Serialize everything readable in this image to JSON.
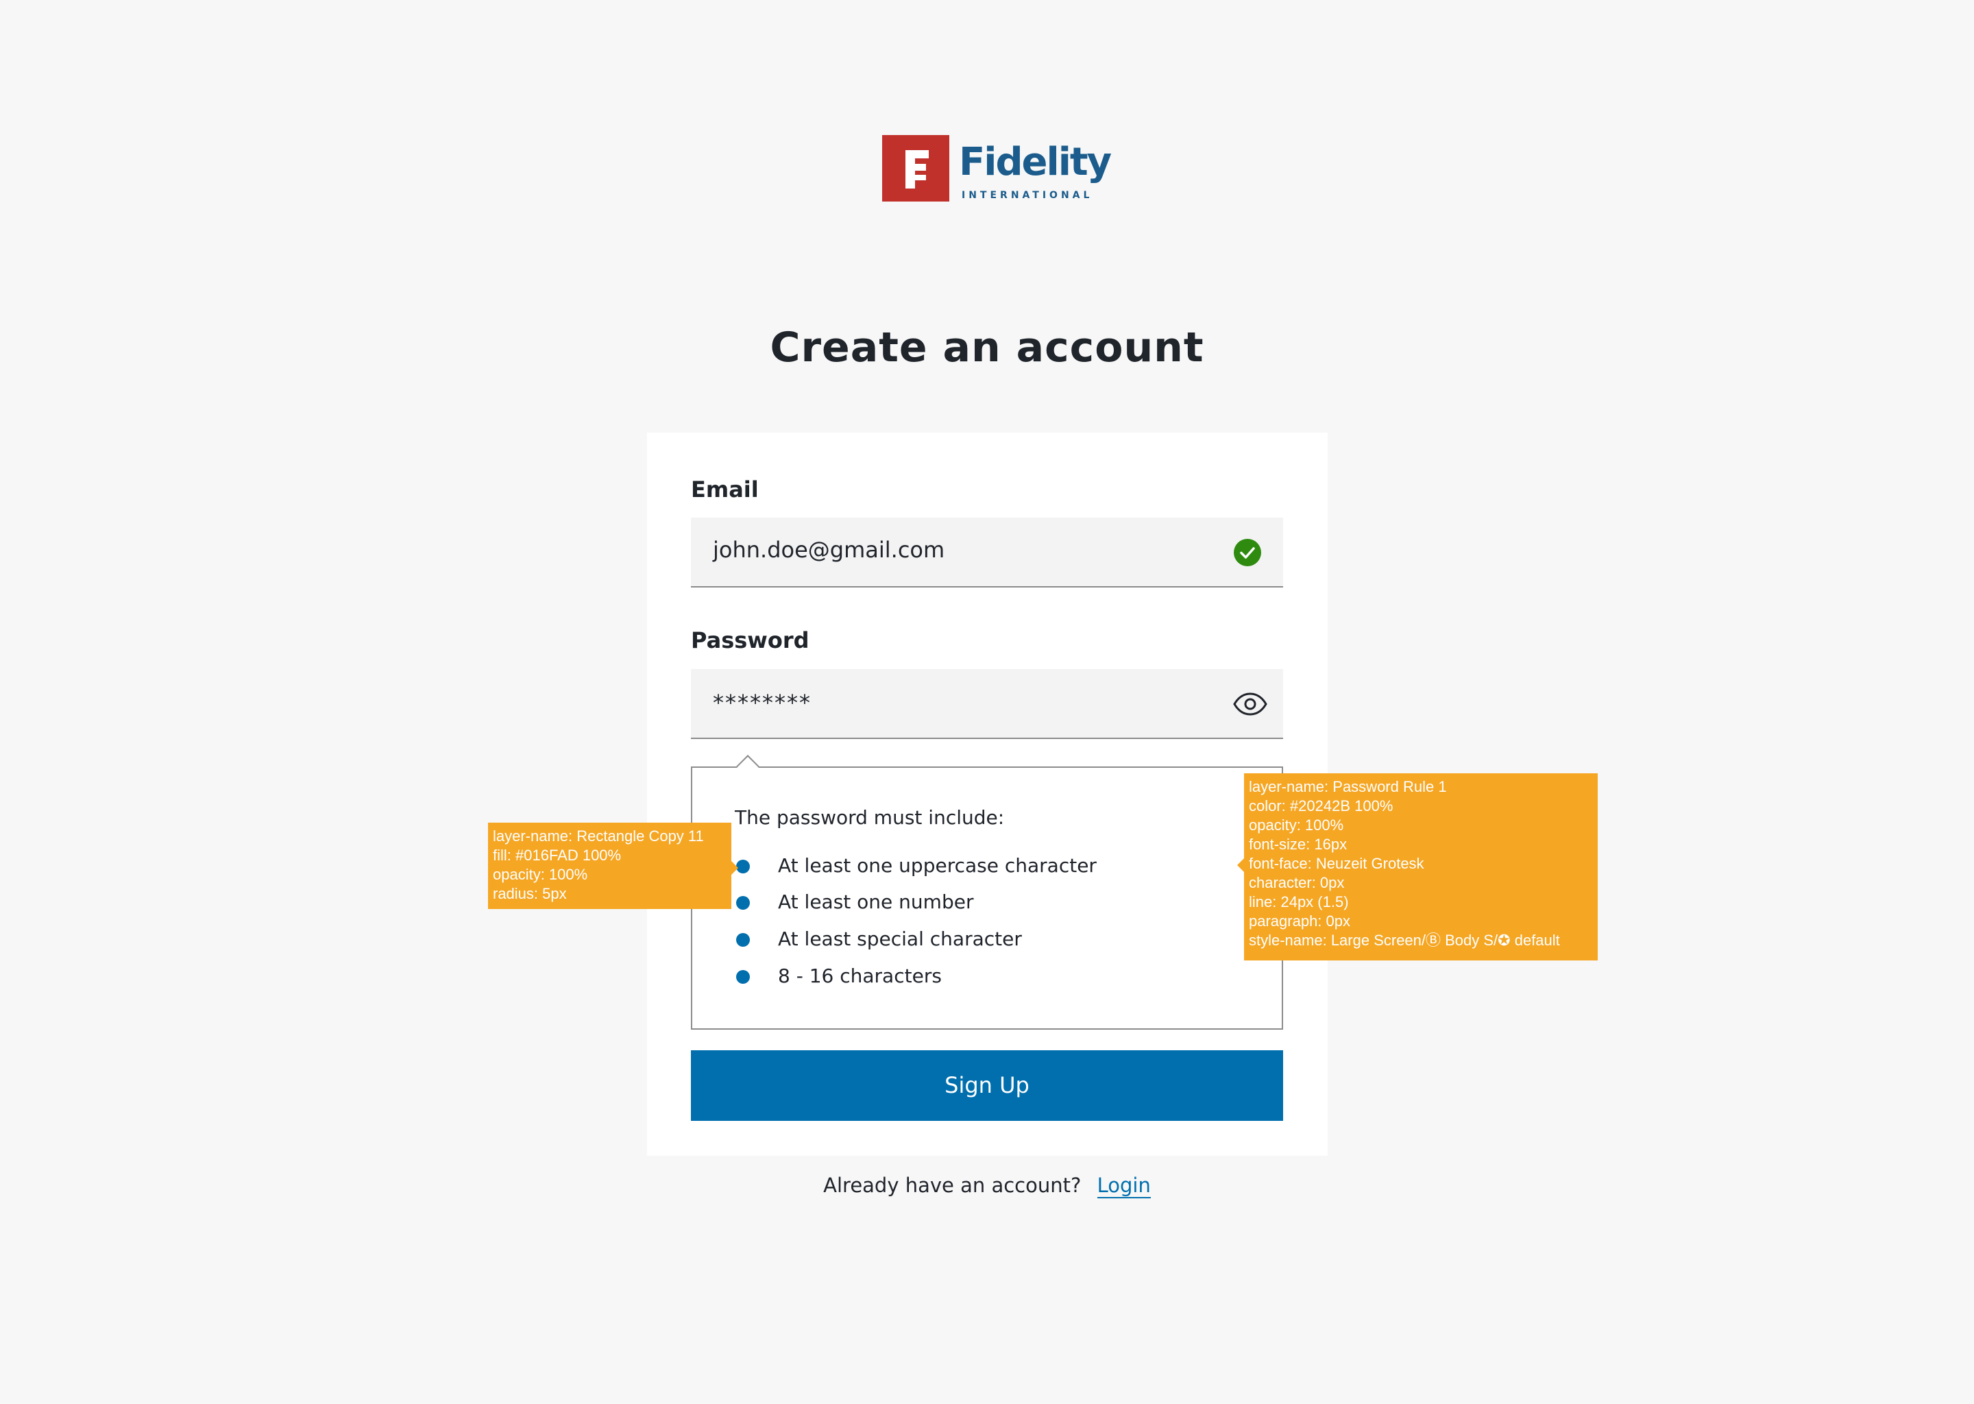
{
  "brand": {
    "logo_letter": "F",
    "name": "Fidelity",
    "sub": "INTERNATIONAL",
    "mark_color": "#c1312c",
    "text_color": "#1b5c8c"
  },
  "page": {
    "title": "Create an account"
  },
  "form": {
    "email": {
      "label": "Email",
      "value": "john.doe@gmail.com",
      "status_icon": "check-circle-icon"
    },
    "password": {
      "label": "Password",
      "value": "********",
      "toggle_icon": "eye-icon"
    },
    "rules": {
      "intro": "The password must include:",
      "items": [
        "At least one uppercase character",
        "At least one number",
        "At least special character",
        "8 - 16 characters"
      ],
      "bullet_color": "#016FAD"
    },
    "submit_label": "Sign Up"
  },
  "footer": {
    "prompt": "Already have an account?",
    "login_label": "Login"
  },
  "annotations": {
    "bullet": [
      "layer-name: Rectangle Copy 11",
      "fill: #016FAD 100%",
      "opacity: 100%",
      "radius: 5px"
    ],
    "rule_text": [
      "layer-name: Password Rule 1",
      "color: #20242B 100%",
      "opacity: 100%",
      "font-size: 16px",
      "font-face: Neuzeit Grotesk",
      "character: 0px",
      "line: 24px (1.5)",
      "paragraph: 0px",
      "style-name: Large Screen/Ⓑ Body S/✪ default"
    ]
  },
  "colors": {
    "accent": "#016FAD",
    "text": "#20242B",
    "success": "#2e8b0f",
    "annotation": "#f5a623"
  }
}
